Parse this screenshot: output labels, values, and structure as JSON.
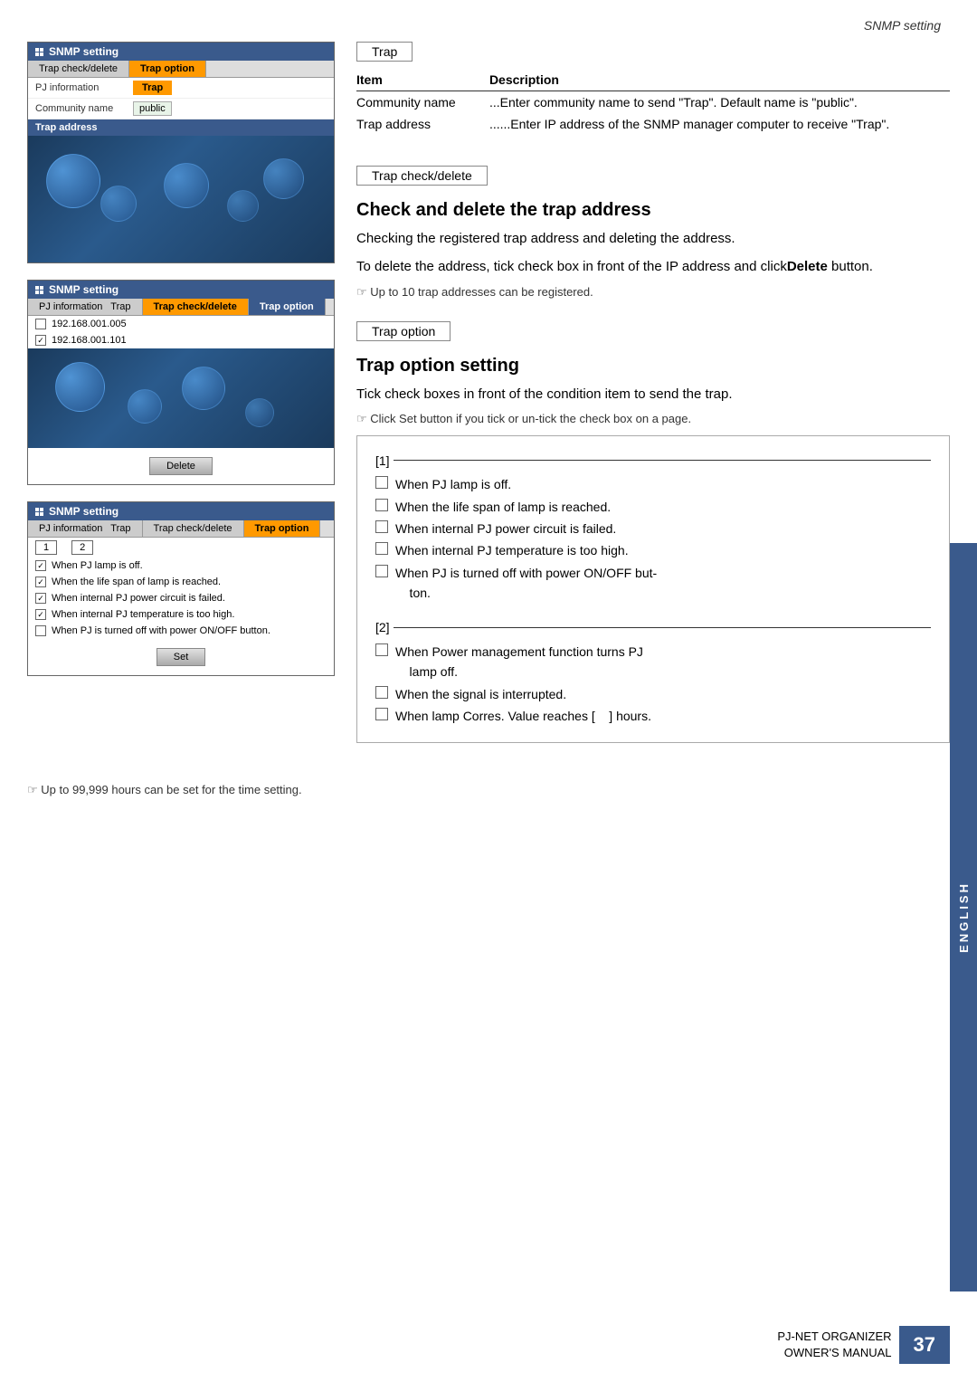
{
  "page": {
    "header": "SNMP setting",
    "footer_text1": "PJ-NET ORGANIZER",
    "footer_text2": "OWNER'S MANUAL",
    "page_number": "37",
    "lang_tab": "ENGLISH",
    "bottom_note": "Up to 99,999 hours can be set for the time setting."
  },
  "panels": {
    "panel1": {
      "title": "SNMP setting",
      "tab1": "Trap check/delete",
      "tab2": "Trap option",
      "row1_label": "PJ information",
      "row1_value": "Trap",
      "row2_label": "Community name",
      "row2_value": "public",
      "address_label": "Trap address"
    },
    "panel2": {
      "title": "SNMP setting",
      "tab1": "PJ information",
      "tab1b": "Trap",
      "tab2": "Trap check/delete",
      "tab3": "Trap option",
      "ip1": "192.168.001.005",
      "ip2": "192.168.001.101",
      "delete_btn": "Delete"
    },
    "panel3": {
      "title": "SNMP setting",
      "tab1": "PJ information",
      "tab1b": "Trap",
      "tab2": "Trap check/delete",
      "tab3": "Trap option",
      "num1": "1",
      "num2": "2",
      "cb1": "When PJ lamp is off.",
      "cb2": "When the life span of lamp is reached.",
      "cb3": "When internal PJ power circuit is failed.",
      "cb4": "When internal PJ temperature is too high.",
      "cb5": "When PJ is turned off with power ON/OFF button.",
      "set_btn": "Set"
    }
  },
  "right": {
    "section1": {
      "label": "Trap",
      "col1": "Item",
      "col2": "Description",
      "row1_item": "Community name",
      "row1_desc": "...Enter community name to send \"Trap\". Default name is \"public\".",
      "row2_item": "Trap address",
      "row2_desc": "......Enter IP address of the SNMP manager computer to receive \"Trap\"."
    },
    "section2": {
      "label": "Trap check/delete",
      "title": "Check and delete the trap address",
      "body1": "Checking the registered trap address and deleting the address.",
      "body2": "To delete the address, tick check box in front of the IP address and click",
      "body2_bold": "Delete",
      "body2_end": " button.",
      "note": "Up to 10 trap addresses can be registered."
    },
    "section3": {
      "label": "Trap option",
      "title": "Trap option setting",
      "body1": "Tick check boxes in front of the condition item to send the trap.",
      "note": "Click Set button if you tick or un-tick the check box on a page.",
      "group1_label": "[1]",
      "group1_items": [
        "When PJ lamp is off.",
        "When the life span of lamp is reached.",
        "When internal PJ power circuit is failed.",
        "When internal PJ temperature is too high.",
        "When PJ is turned off with power ON/OFF button."
      ],
      "group2_label": "[2]",
      "group2_items": [
        "When Power management function turns PJ lamp off.",
        "When the signal is interrupted.",
        "When lamp Corres. Value reaches [    ] hours."
      ]
    }
  }
}
